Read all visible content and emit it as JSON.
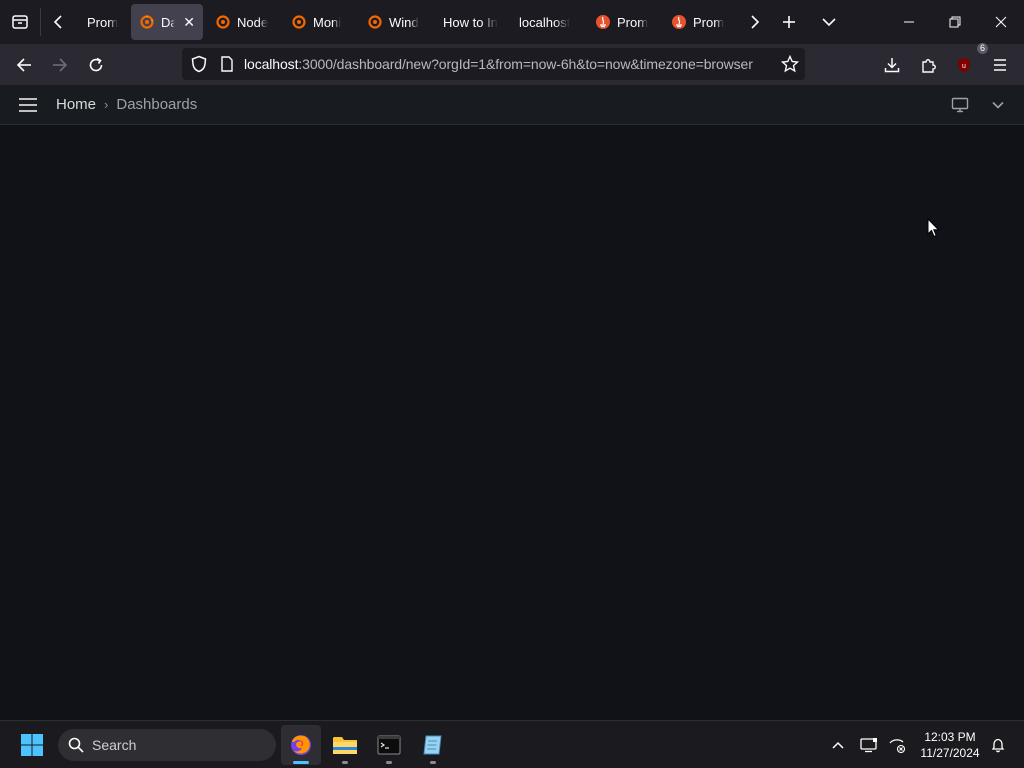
{
  "browser": {
    "tabs": [
      {
        "label": "Prom",
        "favicon": "none",
        "active": false
      },
      {
        "label": "Das",
        "favicon": "grafana-icon",
        "active": true
      },
      {
        "label": "Node",
        "favicon": "grafana-icon",
        "active": false
      },
      {
        "label": "Moni",
        "favicon": "grafana-icon",
        "active": false
      },
      {
        "label": "Wind",
        "favicon": "grafana-icon",
        "active": false
      },
      {
        "label": "How to In",
        "favicon": "none",
        "active": false
      },
      {
        "label": "localhost",
        "favicon": "none",
        "active": false
      },
      {
        "label": "Prom",
        "favicon": "prometheus-icon",
        "active": false
      },
      {
        "label": "Prom",
        "favicon": "prometheus-icon",
        "active": false
      }
    ],
    "url_host": "localhost",
    "url_rest": ":3000/dashboard/new?orgId=1&from=now-6h&to=now&timezone=browser",
    "extension_badge": "6"
  },
  "grafana": {
    "breadcrumb_home": "Home",
    "breadcrumb_current": "Dashboards"
  },
  "taskbar": {
    "search_label": "Search",
    "time": "12:03 PM",
    "date": "11/27/2024"
  },
  "colors": {
    "grafana_orange": "#f46800",
    "prometheus_red": "#e6522c",
    "accent_blue": "#4cc2ff",
    "page_bg": "#111217"
  }
}
